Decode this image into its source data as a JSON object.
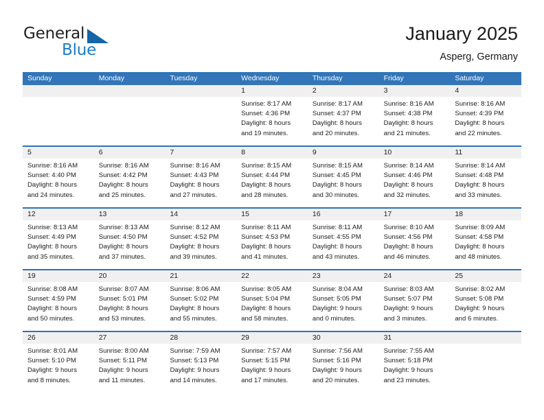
{
  "brand": {
    "name_part1": "General",
    "name_part2": "Blue",
    "triangle_icon": "triangle-icon",
    "accent_blue": "#1c7cc4",
    "logo_dark": "#231f20"
  },
  "header": {
    "title": "January 2025",
    "subtitle": "Asperg, Germany"
  },
  "theme": {
    "header_blue": "#3275b8",
    "row_divider_blue": "#2e71b4",
    "day_band_gray": "#f0f0f0",
    "text_color": "#202020"
  },
  "weekdays": [
    "Sunday",
    "Monday",
    "Tuesday",
    "Wednesday",
    "Thursday",
    "Friday",
    "Saturday"
  ],
  "weeks": [
    [
      {
        "day": "",
        "empty": true,
        "sunrise": "",
        "sunset": "",
        "daylight_1": "",
        "daylight_2": ""
      },
      {
        "day": "",
        "empty": true,
        "sunrise": "",
        "sunset": "",
        "daylight_1": "",
        "daylight_2": ""
      },
      {
        "day": "",
        "empty": true,
        "sunrise": "",
        "sunset": "",
        "daylight_1": "",
        "daylight_2": ""
      },
      {
        "day": "1",
        "sunrise": "Sunrise: 8:17 AM",
        "sunset": "Sunset: 4:36 PM",
        "daylight_1": "Daylight: 8 hours",
        "daylight_2": "and 19 minutes."
      },
      {
        "day": "2",
        "sunrise": "Sunrise: 8:17 AM",
        "sunset": "Sunset: 4:37 PM",
        "daylight_1": "Daylight: 8 hours",
        "daylight_2": "and 20 minutes."
      },
      {
        "day": "3",
        "sunrise": "Sunrise: 8:16 AM",
        "sunset": "Sunset: 4:38 PM",
        "daylight_1": "Daylight: 8 hours",
        "daylight_2": "and 21 minutes."
      },
      {
        "day": "4",
        "sunrise": "Sunrise: 8:16 AM",
        "sunset": "Sunset: 4:39 PM",
        "daylight_1": "Daylight: 8 hours",
        "daylight_2": "and 22 minutes."
      }
    ],
    [
      {
        "day": "5",
        "sunrise": "Sunrise: 8:16 AM",
        "sunset": "Sunset: 4:40 PM",
        "daylight_1": "Daylight: 8 hours",
        "daylight_2": "and 24 minutes."
      },
      {
        "day": "6",
        "sunrise": "Sunrise: 8:16 AM",
        "sunset": "Sunset: 4:42 PM",
        "daylight_1": "Daylight: 8 hours",
        "daylight_2": "and 25 minutes."
      },
      {
        "day": "7",
        "sunrise": "Sunrise: 8:16 AM",
        "sunset": "Sunset: 4:43 PM",
        "daylight_1": "Daylight: 8 hours",
        "daylight_2": "and 27 minutes."
      },
      {
        "day": "8",
        "sunrise": "Sunrise: 8:15 AM",
        "sunset": "Sunset: 4:44 PM",
        "daylight_1": "Daylight: 8 hours",
        "daylight_2": "and 28 minutes."
      },
      {
        "day": "9",
        "sunrise": "Sunrise: 8:15 AM",
        "sunset": "Sunset: 4:45 PM",
        "daylight_1": "Daylight: 8 hours",
        "daylight_2": "and 30 minutes."
      },
      {
        "day": "10",
        "sunrise": "Sunrise: 8:14 AM",
        "sunset": "Sunset: 4:46 PM",
        "daylight_1": "Daylight: 8 hours",
        "daylight_2": "and 32 minutes."
      },
      {
        "day": "11",
        "sunrise": "Sunrise: 8:14 AM",
        "sunset": "Sunset: 4:48 PM",
        "daylight_1": "Daylight: 8 hours",
        "daylight_2": "and 33 minutes."
      }
    ],
    [
      {
        "day": "12",
        "sunrise": "Sunrise: 8:13 AM",
        "sunset": "Sunset: 4:49 PM",
        "daylight_1": "Daylight: 8 hours",
        "daylight_2": "and 35 minutes."
      },
      {
        "day": "13",
        "sunrise": "Sunrise: 8:13 AM",
        "sunset": "Sunset: 4:50 PM",
        "daylight_1": "Daylight: 8 hours",
        "daylight_2": "and 37 minutes."
      },
      {
        "day": "14",
        "sunrise": "Sunrise: 8:12 AM",
        "sunset": "Sunset: 4:52 PM",
        "daylight_1": "Daylight: 8 hours",
        "daylight_2": "and 39 minutes."
      },
      {
        "day": "15",
        "sunrise": "Sunrise: 8:11 AM",
        "sunset": "Sunset: 4:53 PM",
        "daylight_1": "Daylight: 8 hours",
        "daylight_2": "and 41 minutes."
      },
      {
        "day": "16",
        "sunrise": "Sunrise: 8:11 AM",
        "sunset": "Sunset: 4:55 PM",
        "daylight_1": "Daylight: 8 hours",
        "daylight_2": "and 43 minutes."
      },
      {
        "day": "17",
        "sunrise": "Sunrise: 8:10 AM",
        "sunset": "Sunset: 4:56 PM",
        "daylight_1": "Daylight: 8 hours",
        "daylight_2": "and 46 minutes."
      },
      {
        "day": "18",
        "sunrise": "Sunrise: 8:09 AM",
        "sunset": "Sunset: 4:58 PM",
        "daylight_1": "Daylight: 8 hours",
        "daylight_2": "and 48 minutes."
      }
    ],
    [
      {
        "day": "19",
        "sunrise": "Sunrise: 8:08 AM",
        "sunset": "Sunset: 4:59 PM",
        "daylight_1": "Daylight: 8 hours",
        "daylight_2": "and 50 minutes."
      },
      {
        "day": "20",
        "sunrise": "Sunrise: 8:07 AM",
        "sunset": "Sunset: 5:01 PM",
        "daylight_1": "Daylight: 8 hours",
        "daylight_2": "and 53 minutes."
      },
      {
        "day": "21",
        "sunrise": "Sunrise: 8:06 AM",
        "sunset": "Sunset: 5:02 PM",
        "daylight_1": "Daylight: 8 hours",
        "daylight_2": "and 55 minutes."
      },
      {
        "day": "22",
        "sunrise": "Sunrise: 8:05 AM",
        "sunset": "Sunset: 5:04 PM",
        "daylight_1": "Daylight: 8 hours",
        "daylight_2": "and 58 minutes."
      },
      {
        "day": "23",
        "sunrise": "Sunrise: 8:04 AM",
        "sunset": "Sunset: 5:05 PM",
        "daylight_1": "Daylight: 9 hours",
        "daylight_2": "and 0 minutes."
      },
      {
        "day": "24",
        "sunrise": "Sunrise: 8:03 AM",
        "sunset": "Sunset: 5:07 PM",
        "daylight_1": "Daylight: 9 hours",
        "daylight_2": "and 3 minutes."
      },
      {
        "day": "25",
        "sunrise": "Sunrise: 8:02 AM",
        "sunset": "Sunset: 5:08 PM",
        "daylight_1": "Daylight: 9 hours",
        "daylight_2": "and 6 minutes."
      }
    ],
    [
      {
        "day": "26",
        "sunrise": "Sunrise: 8:01 AM",
        "sunset": "Sunset: 5:10 PM",
        "daylight_1": "Daylight: 9 hours",
        "daylight_2": "and 8 minutes."
      },
      {
        "day": "27",
        "sunrise": "Sunrise: 8:00 AM",
        "sunset": "Sunset: 5:11 PM",
        "daylight_1": "Daylight: 9 hours",
        "daylight_2": "and 11 minutes."
      },
      {
        "day": "28",
        "sunrise": "Sunrise: 7:59 AM",
        "sunset": "Sunset: 5:13 PM",
        "daylight_1": "Daylight: 9 hours",
        "daylight_2": "and 14 minutes."
      },
      {
        "day": "29",
        "sunrise": "Sunrise: 7:57 AM",
        "sunset": "Sunset: 5:15 PM",
        "daylight_1": "Daylight: 9 hours",
        "daylight_2": "and 17 minutes."
      },
      {
        "day": "30",
        "sunrise": "Sunrise: 7:56 AM",
        "sunset": "Sunset: 5:16 PM",
        "daylight_1": "Daylight: 9 hours",
        "daylight_2": "and 20 minutes."
      },
      {
        "day": "31",
        "sunrise": "Sunrise: 7:55 AM",
        "sunset": "Sunset: 5:18 PM",
        "daylight_1": "Daylight: 9 hours",
        "daylight_2": "and 23 minutes."
      },
      {
        "day": "",
        "empty": true,
        "sunrise": "",
        "sunset": "",
        "daylight_1": "",
        "daylight_2": ""
      }
    ]
  ]
}
